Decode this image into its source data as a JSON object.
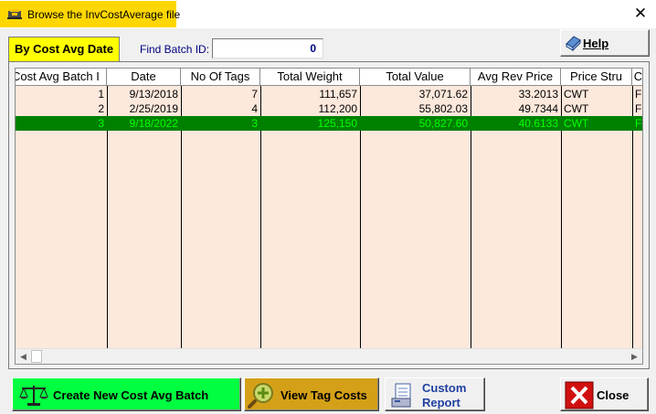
{
  "window": {
    "title": "Browse the InvCostAverage file",
    "close_glyph": "✕"
  },
  "tab": {
    "label": "By Cost Avg Date"
  },
  "find": {
    "label": "Find Batch ID:",
    "value": "0"
  },
  "help_button": {
    "label": "Help",
    "icon": "help-book-icon"
  },
  "grid": {
    "columns": [
      "Cost Avg Batch I",
      "Date",
      "No Of Tags",
      "Total Weight",
      "Total Value",
      "Avg Rev Price",
      "Price Stru",
      "C"
    ],
    "rows": [
      [
        "1",
        "9/13/2018",
        "7",
        "111,657",
        "37,071.62",
        "33.2013",
        "CWT",
        "F"
      ],
      [
        "2",
        "2/25/2019",
        "4",
        "112,200",
        "55,802.03",
        "49.7344",
        "CWT",
        "F"
      ],
      [
        "3",
        "9/18/2022",
        "3",
        "125,150",
        "50,827.60",
        "40.6133",
        "CWT",
        "F"
      ]
    ],
    "selected_row": 2
  },
  "buttons": {
    "create": {
      "label": "Create New Cost Avg Batch",
      "icon": "scales-icon"
    },
    "view": {
      "label": "View Tag Costs",
      "icon": "magnifier-plus-icon"
    },
    "report": {
      "line1": "Custom",
      "line2": "Report",
      "icon": "report-document-icon"
    },
    "close": {
      "label": "Close",
      "icon": "close-x-icon"
    }
  },
  "colors": {
    "title_highlight": "#ffd700",
    "tab": "#ffff00",
    "grid_background": "#fde8dc",
    "selected_row_bg": "#008000",
    "selected_row_text": "#00ff00",
    "create_button": "#00ff40",
    "view_button": "#d4a017"
  }
}
